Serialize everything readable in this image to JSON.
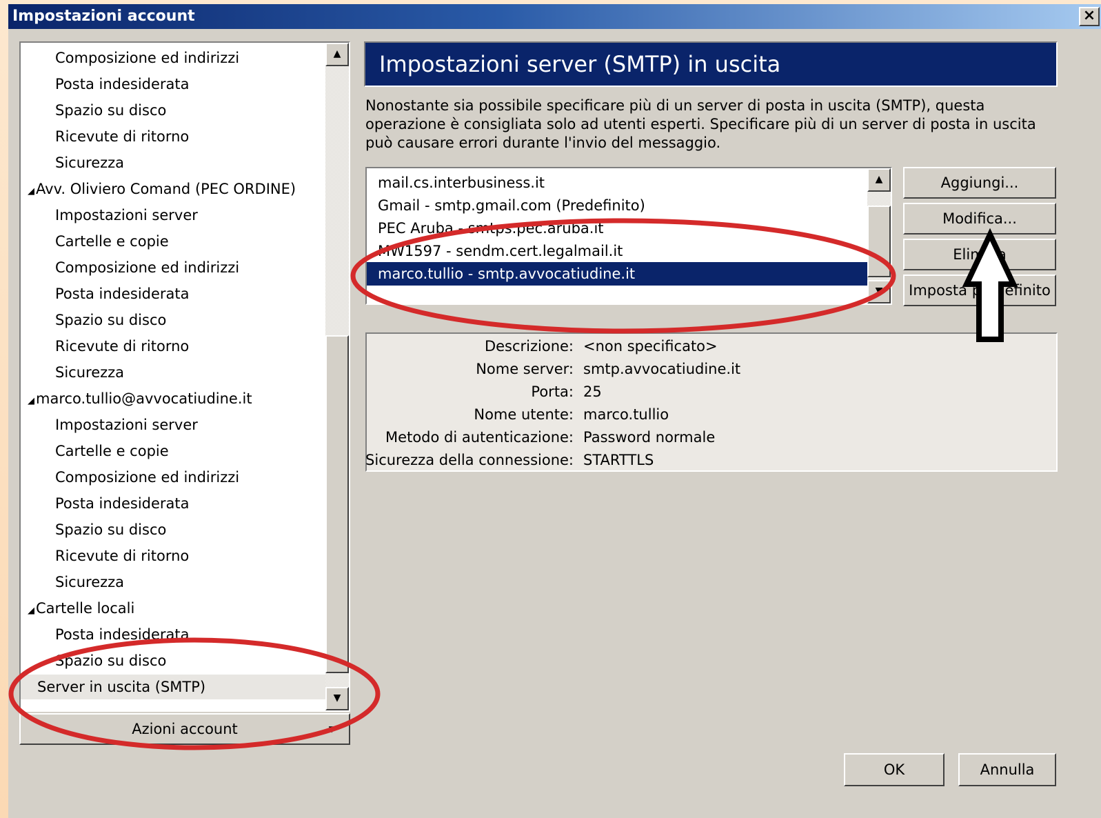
{
  "window": {
    "title": "Impostazioni account",
    "close_label": "×"
  },
  "tree": {
    "items": [
      {
        "label": "Composizione ed indirizzi",
        "kind": "sub"
      },
      {
        "label": "Posta indesiderata",
        "kind": "sub"
      },
      {
        "label": "Spazio su disco",
        "kind": "sub"
      },
      {
        "label": "Ricevute di ritorno",
        "kind": "sub"
      },
      {
        "label": "Sicurezza",
        "kind": "sub"
      },
      {
        "label": "Avv. Oliviero Comand (PEC ORDINE)",
        "kind": "acct"
      },
      {
        "label": "Impostazioni server",
        "kind": "sub"
      },
      {
        "label": "Cartelle e copie",
        "kind": "sub"
      },
      {
        "label": "Composizione ed indirizzi",
        "kind": "sub"
      },
      {
        "label": "Posta indesiderata",
        "kind": "sub"
      },
      {
        "label": "Spazio su disco",
        "kind": "sub"
      },
      {
        "label": "Ricevute di ritorno",
        "kind": "sub"
      },
      {
        "label": "Sicurezza",
        "kind": "sub"
      },
      {
        "label": "marco.tullio@avvocatiudine.it",
        "kind": "acct"
      },
      {
        "label": "Impostazioni server",
        "kind": "sub"
      },
      {
        "label": "Cartelle e copie",
        "kind": "sub"
      },
      {
        "label": "Composizione ed indirizzi",
        "kind": "sub"
      },
      {
        "label": "Posta indesiderata",
        "kind": "sub"
      },
      {
        "label": "Spazio su disco",
        "kind": "sub"
      },
      {
        "label": "Ricevute di ritorno",
        "kind": "sub"
      },
      {
        "label": "Sicurezza",
        "kind": "sub"
      },
      {
        "label": "Cartelle locali",
        "kind": "acct"
      },
      {
        "label": "Posta indesiderata",
        "kind": "sub"
      },
      {
        "label": "Spazio su disco",
        "kind": "sub"
      },
      {
        "label": "Server in uscita (SMTP)",
        "kind": "selected"
      }
    ],
    "expander_glyph": "◢",
    "scroll_up": "▲",
    "scroll_down": "▼"
  },
  "account_actions": {
    "label": "Azioni account",
    "caret": "▼"
  },
  "panel": {
    "title": "Impostazioni server (SMTP) in uscita",
    "description": "Nonostante sia possibile specificare più di un server di posta in uscita (SMTP), questa operazione è consigliata solo ad utenti esperti. Specificare più di un server di posta in uscita può causare errori durante l'invio del messaggio."
  },
  "servers": {
    "rows": [
      {
        "label": "mail.cs.interbusiness.it",
        "selected": false
      },
      {
        "label": "Gmail - smtp.gmail.com (Predefinito)",
        "selected": false
      },
      {
        "label": "PEC Aruba - smtps.pec.aruba.it",
        "selected": false
      },
      {
        "label": "MW1597 - sendm.cert.legalmail.it",
        "selected": false
      },
      {
        "label": "marco.tullio - smtp.avvocatiudine.it",
        "selected": true
      }
    ]
  },
  "buttons": {
    "add": "Aggiungi...",
    "edit": "Modifica...",
    "remove": "Elimina",
    "set_default": "Imposta predefinito",
    "ok": "OK",
    "cancel": "Annulla"
  },
  "details": {
    "rows": [
      {
        "label": "Descrizione:",
        "value": "<non specificato>"
      },
      {
        "label": "Nome server:",
        "value": "smtp.avvocatiudine.it"
      },
      {
        "label": "Porta:",
        "value": "25"
      },
      {
        "label": "Nome utente:",
        "value": "marco.tullio"
      },
      {
        "label": "Metodo di autenticazione:",
        "value": "Password normale"
      },
      {
        "label": "Sicurezza della connessione:",
        "value": "STARTTLS"
      }
    ]
  },
  "colors": {
    "selection": "#0a246a",
    "dialog_bg": "#d4d0c8",
    "annotation_red": "#d42a2a"
  }
}
